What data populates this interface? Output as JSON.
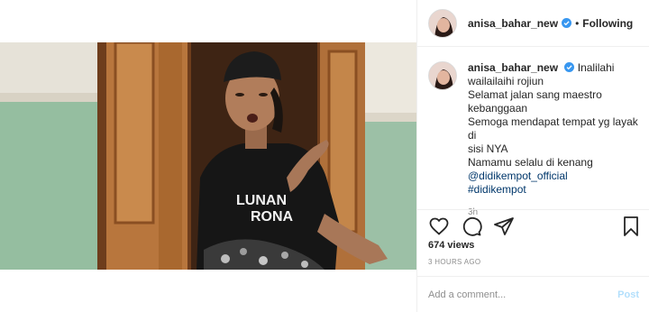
{
  "post": {
    "username": "anisa_bahar_new",
    "follow_status": "Following",
    "separator": "•",
    "caption_lines": [
      "Inalilahi",
      "wailailaihi rojiun",
      "Selamat jalan sang maestro",
      "kebanggaan",
      "Semoga mendapat tempat yg layak di",
      "sisi NYA",
      "Namamu selalu di kenang"
    ],
    "mention": "@didikempot_official",
    "hashtag": "#didikempot",
    "caption_time": "3h",
    "views": "674 views",
    "posted_ago": "3 HOURS AGO"
  },
  "media": {
    "shirt_text_line1": "LUNAN",
    "shirt_text_line2": "RONA"
  },
  "comment": {
    "placeholder": "Add a comment...",
    "post_label": "Post"
  },
  "colors": {
    "verified": "#3897f0",
    "link": "#00376b",
    "post_disabled": "#b2dffc",
    "wall_green": "#8fb89a",
    "door_wood": "#b8763d"
  },
  "icons": [
    "verified-badge-icon",
    "heart-icon",
    "comment-icon",
    "share-icon",
    "bookmark-icon"
  ]
}
